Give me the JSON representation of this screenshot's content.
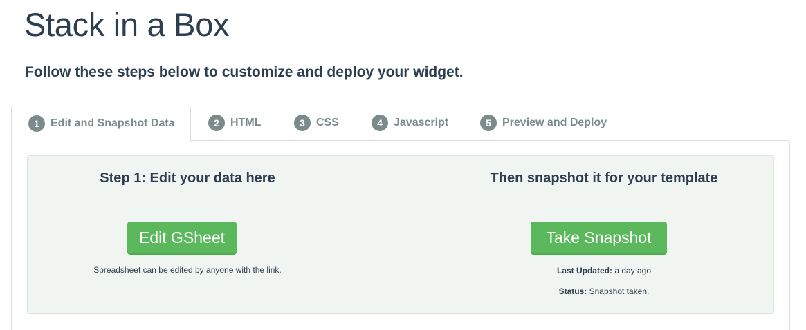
{
  "header": {
    "title": "Stack in a Box",
    "subtitle": "Follow these steps below to customize and deploy your widget."
  },
  "tabs": [
    {
      "number": "1",
      "label": "Edit and Snapshot Data",
      "active": true
    },
    {
      "number": "2",
      "label": "HTML",
      "active": false
    },
    {
      "number": "3",
      "label": "CSS",
      "active": false
    },
    {
      "number": "4",
      "label": "Javascript",
      "active": false
    },
    {
      "number": "5",
      "label": "Preview and Deploy",
      "active": false
    }
  ],
  "step1": {
    "left": {
      "heading": "Step 1: Edit your data here",
      "button_label": "Edit GSheet",
      "note": "Spreadsheet can be edited by anyone with the link."
    },
    "right": {
      "heading": "Then snapshot it for your template",
      "button_label": "Take Snapshot",
      "last_updated_label": "Last Updated:",
      "last_updated_value": " a day ago",
      "status_label": "Status:",
      "status_value": " Snapshot taken."
    }
  },
  "colors": {
    "primary_text": "#2c3e50",
    "tab_muted": "#7b8a8b",
    "success_button": "#5cb85c",
    "well_background": "#f1f5f1"
  }
}
